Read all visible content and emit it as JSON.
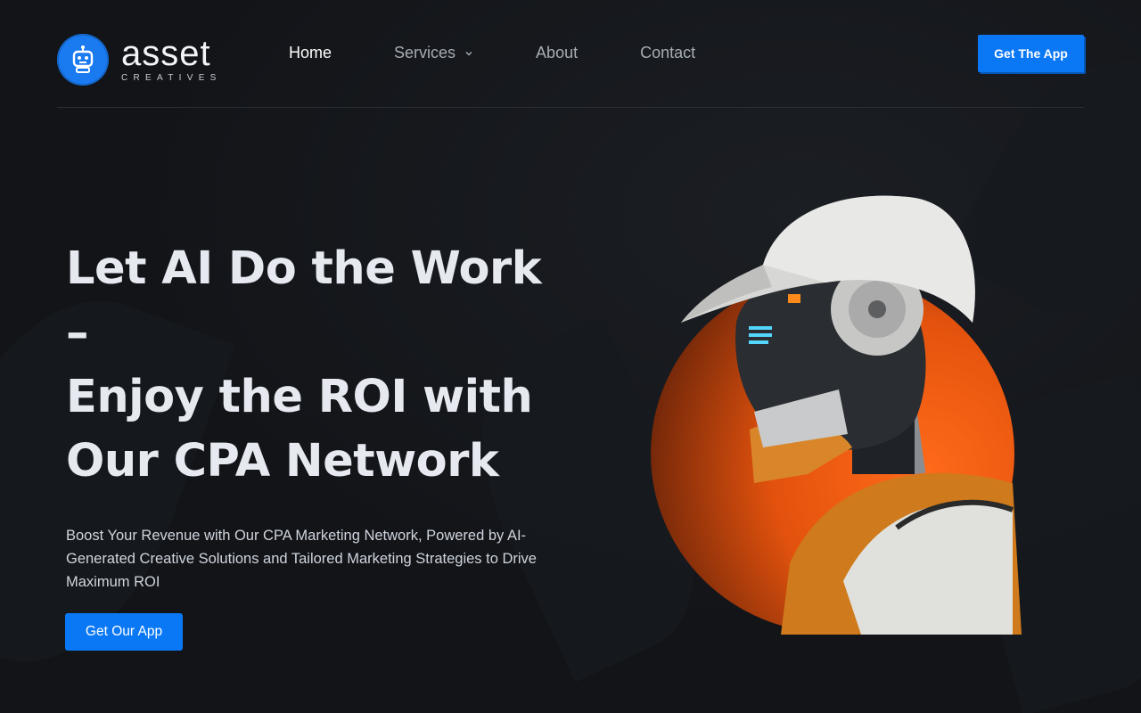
{
  "brand": {
    "name": "asset",
    "tagline": "CREATIVES",
    "logo_icon": "robot-icon",
    "accent_color": "#0a78f5",
    "highlight_color": "#ff6a1a"
  },
  "nav": {
    "items": [
      {
        "label": "Home",
        "active": true
      },
      {
        "label": "Services",
        "has_dropdown": true
      },
      {
        "label": "About"
      },
      {
        "label": "Contact"
      }
    ],
    "cta_label": "Get The App"
  },
  "hero": {
    "title_lines": [
      "Let AI Do the Work –",
      "Enjoy the ROI with",
      "Our CPA Network"
    ],
    "description": "Boost Your Revenue with Our CPA Marketing Network, Powered by AI-Generated Creative Solutions and Tailored Marketing Strategies to Drive Maximum ROI",
    "cta_label": "Get Our App"
  }
}
